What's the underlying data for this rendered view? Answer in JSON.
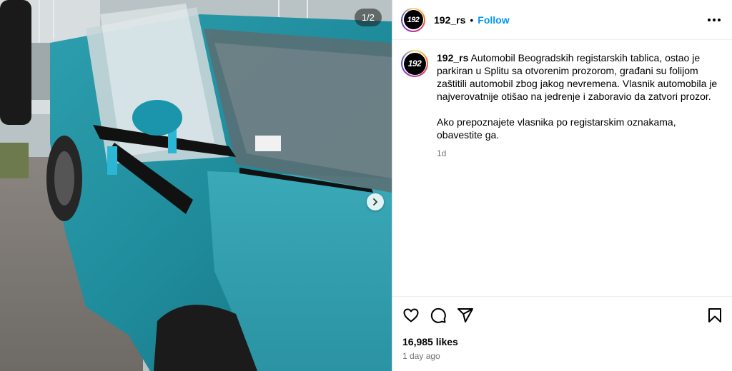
{
  "media": {
    "counter": "1/2",
    "description_icon": "car-photo"
  },
  "account": {
    "username": "192_rs",
    "avatar_text": "192",
    "separator": "•",
    "follow_label": "Follow"
  },
  "caption": {
    "username": "192_rs",
    "paragraph1": "Automobil Beogradskih registarskih tablica, ostao je parkiran u Splitu sa otvorenim prozorom, građani su folijom zaštitili automobil zbog jakog nevremena. Vlasnik automobila je najverovatnije otišao na jedrenje i zaboravio da zatvori prozor.",
    "paragraph2": "Ako prepoznajete vlasnika po registarskim oznakama, obavestite ga.",
    "age": "1d"
  },
  "actions": {
    "icons": [
      "heart-icon",
      "comment-icon",
      "share-icon",
      "bookmark-icon"
    ]
  },
  "stats": {
    "likes": "16,985 likes",
    "posted": "1 day ago"
  },
  "colors": {
    "follow": "#0095f6",
    "muted": "#737373",
    "car": "#2a9fb0"
  }
}
